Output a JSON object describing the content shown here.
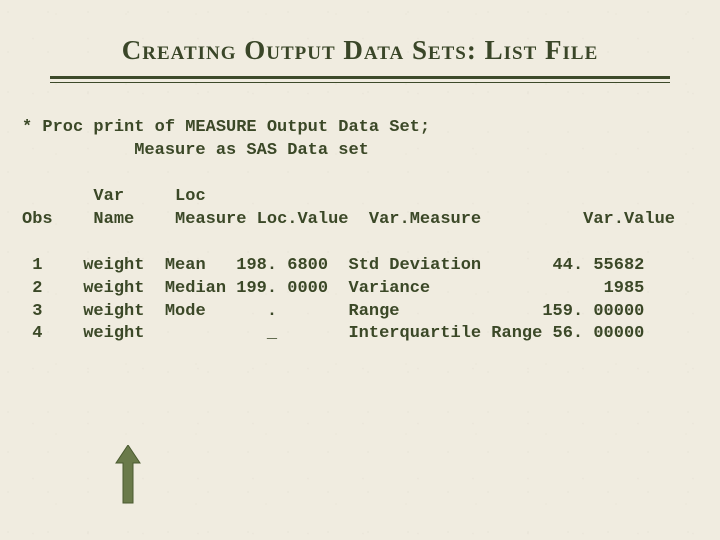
{
  "title": "Creating Output Data Sets: List File",
  "comment": "* Proc print of MEASURE Output Data Set;",
  "subtitle": "Measure as SAS Data set",
  "headers": {
    "obs": "Obs",
    "varname_l1": "Var",
    "varname_l2": "Name",
    "loc_l1": "Loc",
    "loc_l2": "Measure",
    "locvalue": "Loc.Value",
    "varmeasure": "Var.Measure",
    "varvalue": "Var.Value"
  },
  "rows": [
    {
      "obs": "1",
      "varname": "weight",
      "locmeasure": "Mean",
      "locvalue": "198. 6800",
      "varmeasure": "Std Deviation",
      "varvalue": "44. 55682"
    },
    {
      "obs": "2",
      "varname": "weight",
      "locmeasure": "Median",
      "locvalue": "199. 0000",
      "varmeasure": "Variance",
      "varvalue": "1985"
    },
    {
      "obs": "3",
      "varname": "weight",
      "locmeasure": "Mode",
      "locvalue": ".",
      "varmeasure": "Range",
      "varvalue": "159. 00000"
    },
    {
      "obs": "4",
      "varname": "weight",
      "locmeasure": "",
      "locvalue": "_",
      "varmeasure": "Interquartile Range",
      "varvalue": "56. 00000"
    }
  ]
}
